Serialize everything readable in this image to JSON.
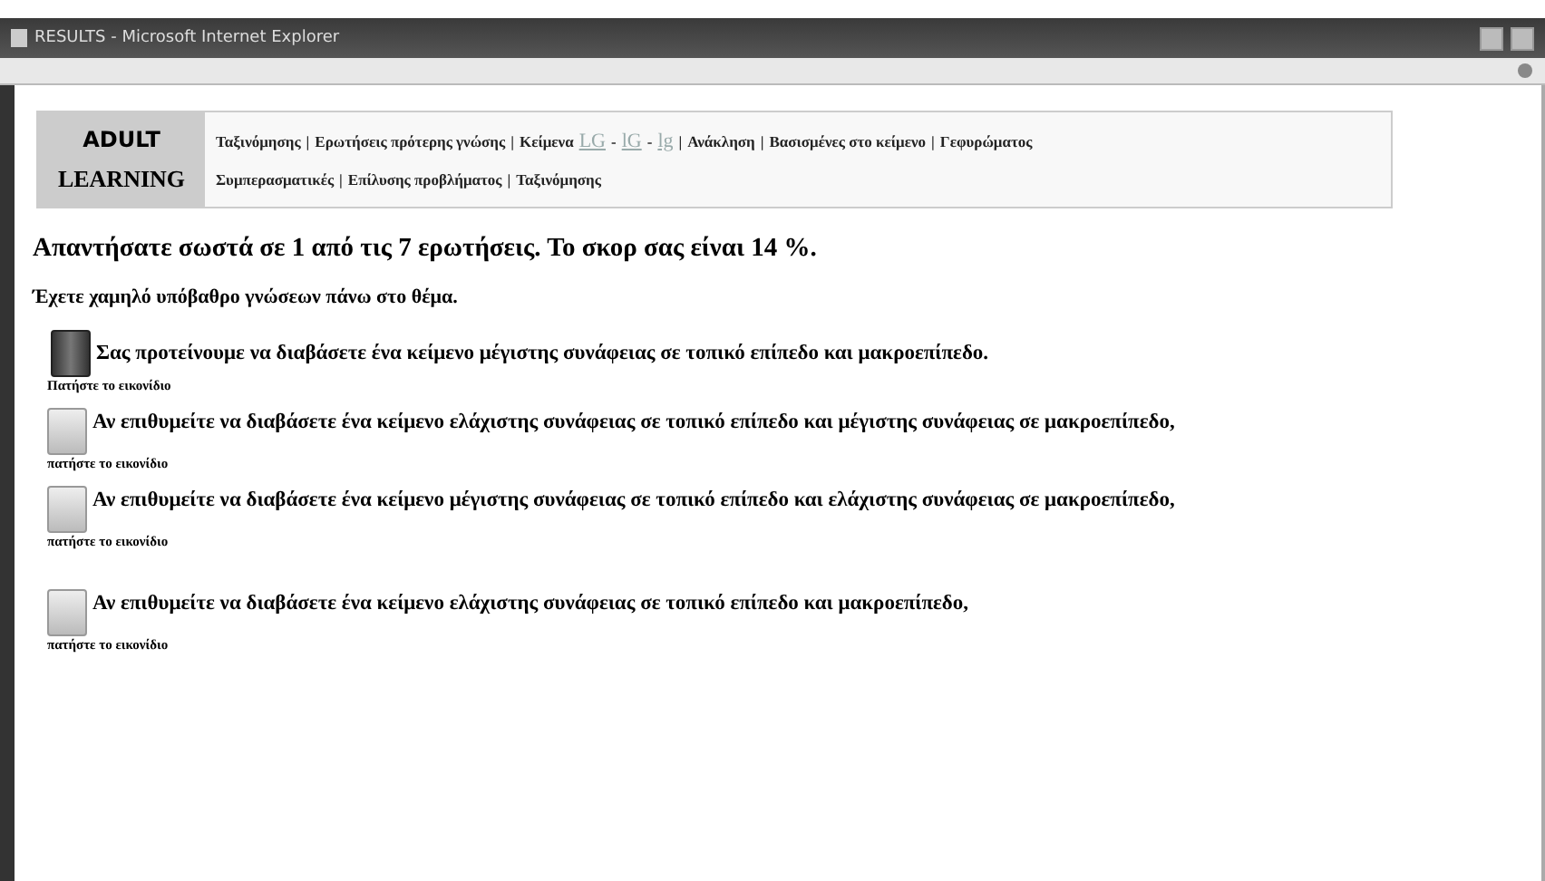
{
  "window": {
    "title": "RESULTS - Microsoft Internet Explorer"
  },
  "header": {
    "logo_lines": [
      "ADULT",
      "LEARNING"
    ],
    "nav_lines": [
      [
        {
          "kind": "text",
          "text": "Ταξινόμησης"
        },
        {
          "kind": "sep",
          "text": "|"
        },
        {
          "kind": "text",
          "text": "Ερωτήσεις πρότερης γνώσης"
        },
        {
          "kind": "sep",
          "text": "|"
        },
        {
          "kind": "text",
          "text": "Κείμενα"
        },
        {
          "kind": "link",
          "text": "LG"
        },
        {
          "kind": "sep",
          "text": "-"
        },
        {
          "kind": "link",
          "text": "lG"
        },
        {
          "kind": "sep",
          "text": "-"
        },
        {
          "kind": "link",
          "text": "lg"
        },
        {
          "kind": "sep",
          "text": "|"
        },
        {
          "kind": "text",
          "text": "Ανάκληση"
        },
        {
          "kind": "sep",
          "text": "|"
        },
        {
          "kind": "text",
          "text": "Βασισμένες στο κείμενο"
        },
        {
          "kind": "sep",
          "text": "|"
        },
        {
          "kind": "text",
          "text": "Γεφυρώματος"
        }
      ],
      [
        {
          "kind": "text",
          "text": "Συμπερασματικές"
        },
        {
          "kind": "sep",
          "text": "|"
        },
        {
          "kind": "text",
          "text": "Επίλυσης προβλήματος"
        },
        {
          "kind": "sep",
          "text": "|"
        },
        {
          "kind": "text",
          "text": "Ταξινόμησης"
        }
      ]
    ]
  },
  "score": "Απαντήσατε σωστά σε 1 από τις 7 ερωτήσεις. Το σκορ σας είναι 14 %.",
  "level": "Έχετε χαμηλό υπόβαθρο γνώσεων πάνω στο θέμα.",
  "suggestions": [
    {
      "highlighted": true,
      "text": "Σας προτείνουμε να διαβάσετε ένα κείμενο μέγιστης συνάφειας σε τοπικό επίπεδο και μακροεπίπεδο.",
      "note": "Πατήστε το εικονίδιο"
    },
    {
      "highlighted": false,
      "text": "Αν επιθυμείτε να διαβάσετε ένα κείμενο ελάχιστης συνάφειας σε τοπικό επίπεδο και μέγιστης συνάφειας σε μακροεπίπεδο,",
      "note": "πατήστε το εικονίδιο"
    },
    {
      "highlighted": false,
      "text": "Αν επιθυμείτε να διαβάσετε ένα κείμενο μέγιστης συνάφειας σε τοπικό επίπεδο και ελάχιστης συνάφειας σε μακροεπίπεδο,",
      "note": "πατήστε το εικονίδιο"
    },
    {
      "highlighted": false,
      "text": "Αν επιθυμείτε να διαβάσετε ένα κείμενο ελάχιστης συνάφειας σε τοπικό επίπεδο και μακροεπίπεδο,",
      "note": "πατήστε το εικονίδιο"
    }
  ]
}
